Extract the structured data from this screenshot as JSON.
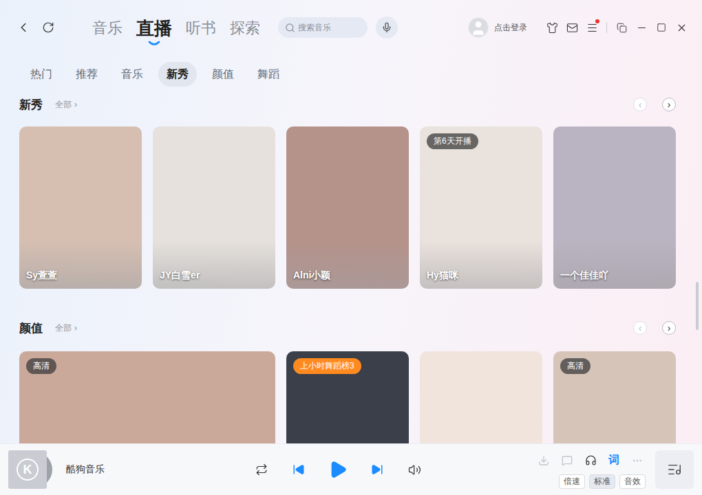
{
  "main_tabs": [
    {
      "label": "音乐",
      "selected": false
    },
    {
      "label": "直播",
      "selected": true
    },
    {
      "label": "听书",
      "selected": false
    },
    {
      "label": "探索",
      "selected": false
    }
  ],
  "search": {
    "placeholder": "搜索音乐"
  },
  "user": {
    "login": "点击登录",
    "notification": true
  },
  "sub_tabs": [
    {
      "label": "热门",
      "selected": false
    },
    {
      "label": "推荐",
      "selected": false
    },
    {
      "label": "音乐",
      "selected": false
    },
    {
      "label": "新秀",
      "selected": true
    },
    {
      "label": "颜值",
      "selected": false
    },
    {
      "label": "舞蹈",
      "selected": false
    }
  ],
  "sections": [
    {
      "title": "新秀",
      "more": "全部",
      "more_arrow": "›",
      "prev": "‹",
      "next": "›",
      "prev_enabled": false,
      "cards": [
        {
          "name": "Sy萱萱",
          "kind": "portrait",
          "color": "#d6bfb1",
          "badge": null
        },
        {
          "name": "JY白雪er",
          "kind": "portrait",
          "color": "#e6e1dc",
          "badge": null
        },
        {
          "name": "Alni小颖",
          "kind": "portrait",
          "color": "#b5928a",
          "badge": null
        },
        {
          "name": "Hy猫咪",
          "kind": "portrait",
          "color": "#e9e2dd",
          "badge": {
            "text": "第6天开播",
            "color": "#4a4a4a"
          }
        },
        {
          "name": "一个佳佳吖",
          "kind": "portrait",
          "color": "#bab4c2",
          "badge": null
        }
      ]
    },
    {
      "title": "颜值",
      "more": "全部",
      "more_arrow": "›",
      "prev": "‹",
      "next": "›",
      "prev_enabled": false,
      "cards": [
        {
          "name": "",
          "kind": "wide",
          "color": "#cba99a",
          "badge": {
            "text": "高清",
            "color": "#4a4a4a"
          }
        },
        {
          "name": "",
          "kind": "portrait",
          "color": "#3a3f4a",
          "badge": {
            "text": "上小时舞蹈榜3",
            "color": "#ff8a1f"
          }
        },
        {
          "name": "",
          "kind": "portrait",
          "color": "#f1e4dd",
          "badge": null
        },
        {
          "name": "",
          "kind": "portrait",
          "color": "#d7c4b9",
          "badge": {
            "text": "高清",
            "color": "#4a4a4a"
          }
        }
      ]
    }
  ],
  "player": {
    "logo": "K",
    "title": "酷狗音乐",
    "playing": false,
    "lyrics_label": "词",
    "lyrics_on": true,
    "options": [
      {
        "label": "倍速",
        "selected": false
      },
      {
        "label": "标准",
        "selected": true
      },
      {
        "label": "音效",
        "selected": false
      }
    ]
  }
}
